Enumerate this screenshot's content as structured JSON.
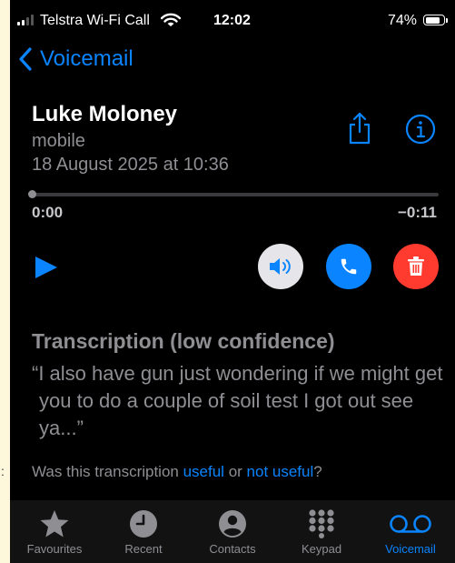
{
  "status_bar": {
    "carrier": "Telstra Wi-Fi Call",
    "time": "12:02",
    "battery_percent_text": "74%",
    "battery_level": 0.74
  },
  "nav": {
    "back_label": "Voicemail",
    "back_icon": "chevron-left-icon"
  },
  "voicemail": {
    "caller_name": "Luke Moloney",
    "number_type": "mobile",
    "date": "18 August 2025 at 10:36",
    "share_icon": "share-icon",
    "info_icon": "info-icon"
  },
  "playback": {
    "elapsed": "0:00",
    "remaining": "−0:11",
    "progress": 0.0,
    "play_icon": "play-icon",
    "speaker_icon": "speaker-icon",
    "call_icon": "phone-icon",
    "delete_icon": "trash-icon"
  },
  "transcription": {
    "title": "Transcription (low confidence)",
    "text": "“I also have gun just wondering if we might get you to do a couple of soil test I got out see ya...”",
    "feedback_prefix": "Was this transcription ",
    "useful_link": "useful",
    "feedback_middle": " or ",
    "not_useful_link": "not useful",
    "feedback_suffix": "?"
  },
  "tab_bar": {
    "tabs": [
      {
        "label": "Favourites",
        "icon": "star-icon",
        "active": false
      },
      {
        "label": "Recent",
        "icon": "clock-icon",
        "active": false
      },
      {
        "label": "Contacts",
        "icon": "person-icon",
        "active": false
      },
      {
        "label": "Keypad",
        "icon": "keypad-icon",
        "active": false
      },
      {
        "label": "Voicemail",
        "icon": "voicemail-icon",
        "active": true
      }
    ]
  },
  "colors": {
    "accent": "#0a84ff",
    "delete": "#ff3b30",
    "secondary_text": "#8e8e93",
    "background": "#000000"
  }
}
